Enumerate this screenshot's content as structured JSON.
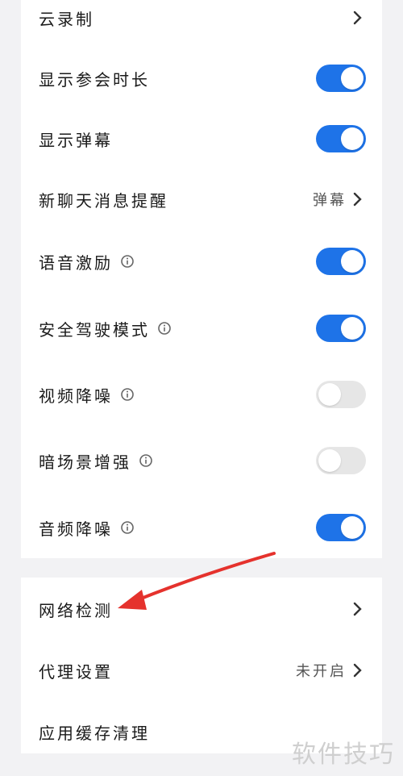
{
  "settings_group_1": {
    "cloud_recording": {
      "label": "云录制"
    },
    "show_duration": {
      "label": "显示参会时长",
      "enabled": true
    },
    "show_danmaku": {
      "label": "显示弹幕",
      "enabled": true
    },
    "new_chat_alert": {
      "label": "新聊天消息提醒",
      "value": "弹幕"
    },
    "voice_motivation": {
      "label": "语音激励",
      "enabled": true
    },
    "safe_driving": {
      "label": "安全驾驶模式",
      "enabled": true
    },
    "video_denoise": {
      "label": "视频降噪",
      "enabled": false
    },
    "dark_scene_enhance": {
      "label": "暗场景增强",
      "enabled": false
    },
    "audio_denoise": {
      "label": "音频降噪",
      "enabled": true
    }
  },
  "settings_group_2": {
    "network_check": {
      "label": "网络检测"
    },
    "proxy_settings": {
      "label": "代理设置",
      "value": "未开启"
    },
    "clear_cache": {
      "label": "应用缓存清理"
    }
  },
  "watermark": "软件技巧",
  "colors": {
    "toggle_on": "#1e73e8",
    "toggle_off": "#e6e6e6",
    "arrow": "#e5322d"
  }
}
